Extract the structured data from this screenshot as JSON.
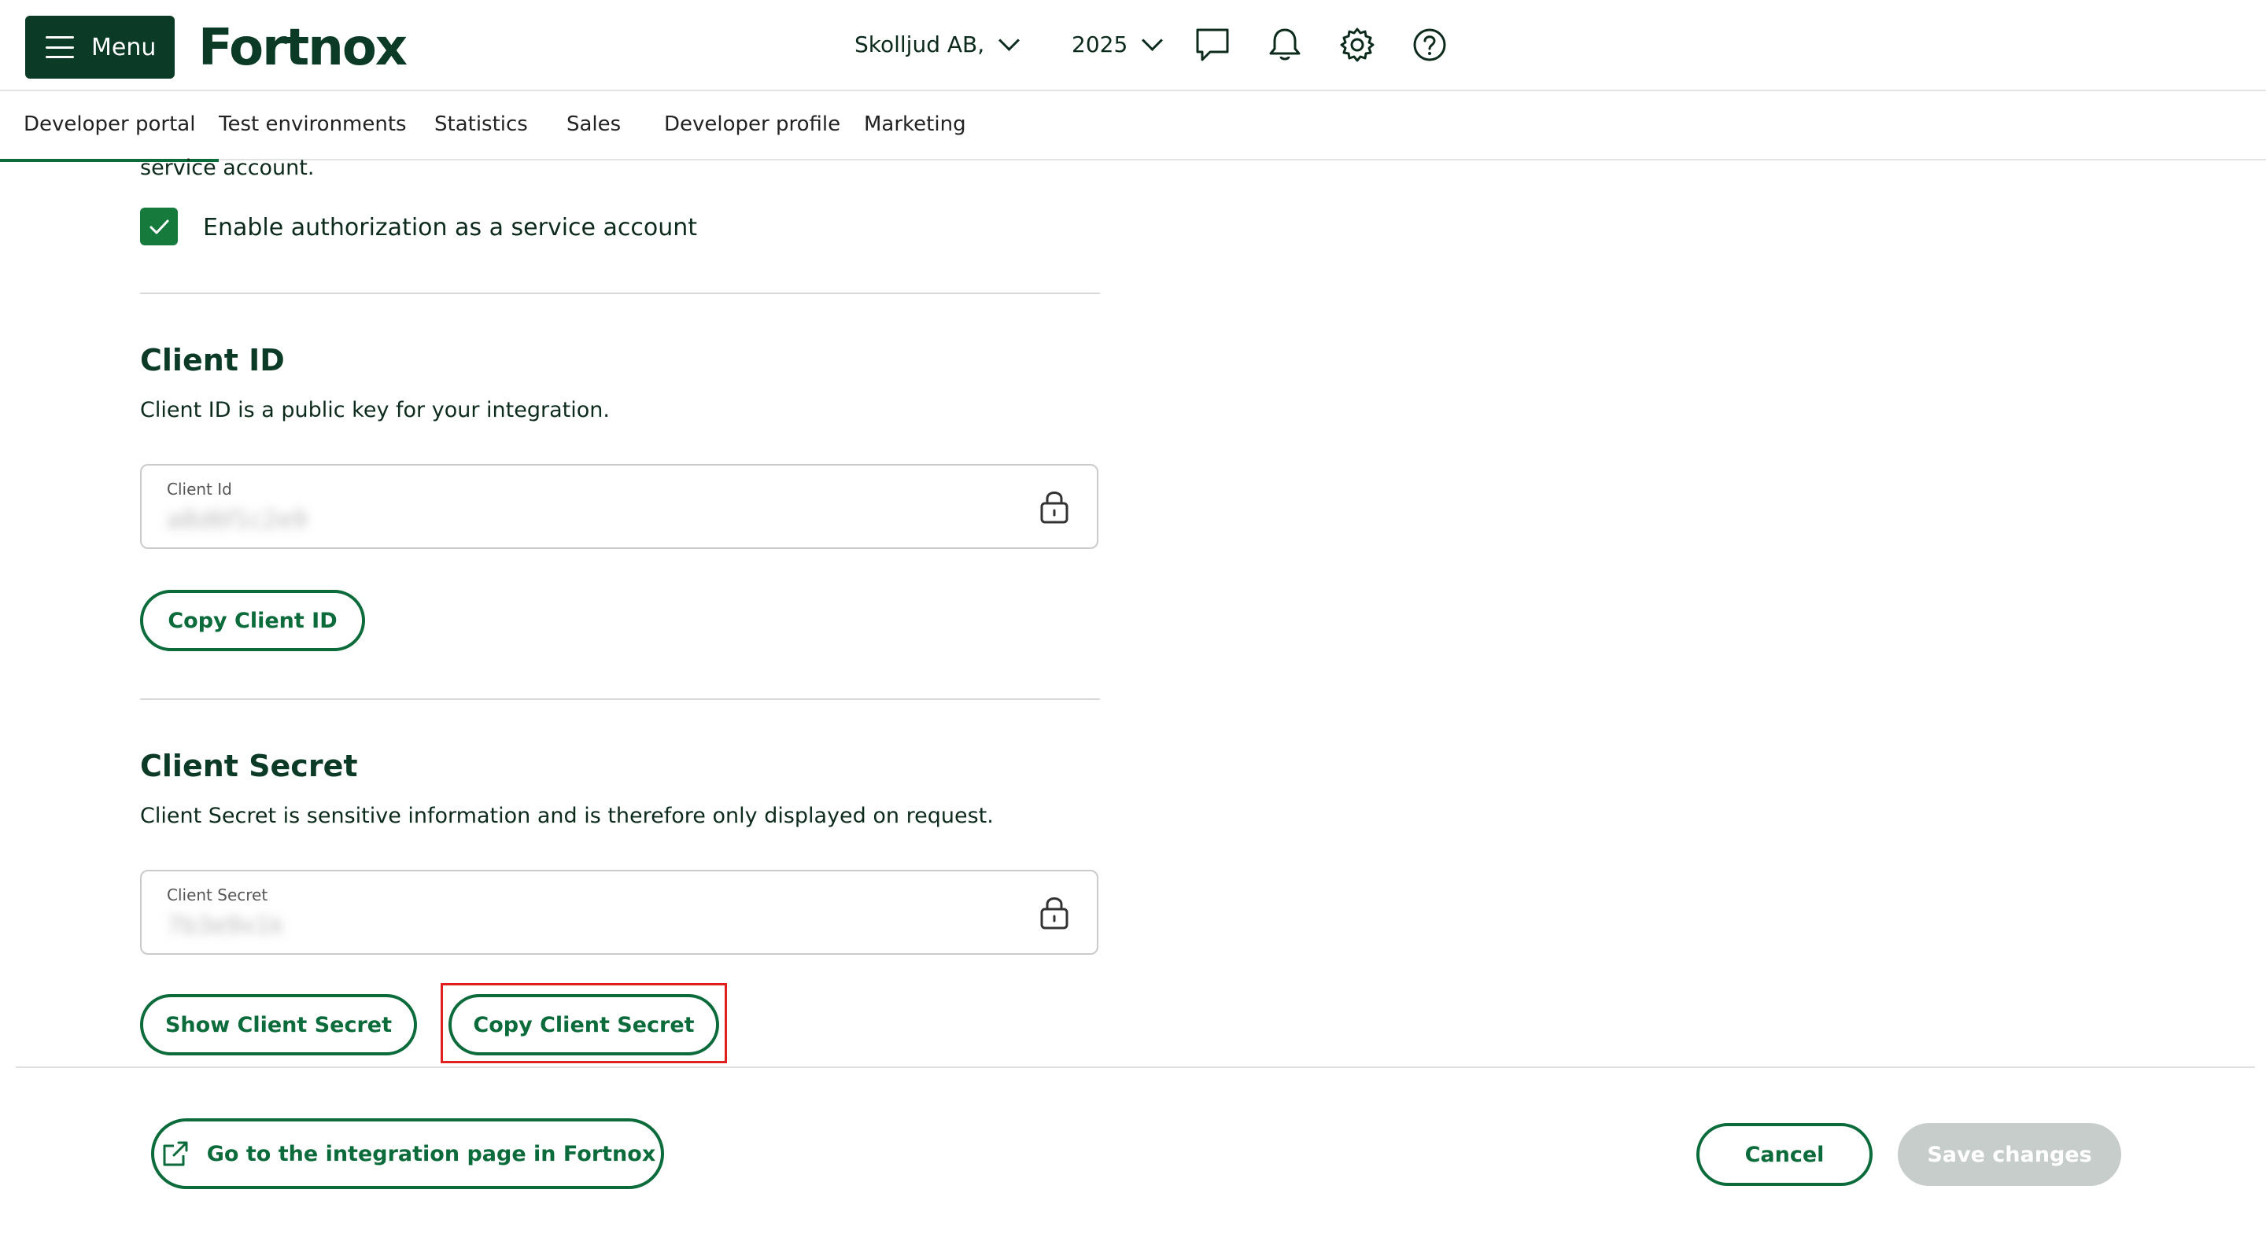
{
  "header": {
    "menu_label": "Menu",
    "logo_text": "Fortnox",
    "company": "Skolljud AB,",
    "year": "2025",
    "icons": [
      "chat-icon",
      "bell-icon",
      "gear-icon",
      "help-icon"
    ]
  },
  "nav": {
    "tabs": [
      {
        "label": "Developer portal",
        "active": true
      },
      {
        "label": "Test environments"
      },
      {
        "label": "Statistics"
      },
      {
        "label": "Sales"
      },
      {
        "label": "Developer profile"
      },
      {
        "label": "Marketing"
      }
    ]
  },
  "service_account": {
    "intro_tail": "service account.",
    "checkbox_label": "Enable authorization as a service account",
    "checked": true
  },
  "client_id": {
    "title": "Client ID",
    "description": "Client ID is a public key for your integration.",
    "field_label": "Client Id",
    "field_value": "a8d6f1c2e9",
    "copy_button": "Copy Client ID"
  },
  "client_secret": {
    "title": "Client Secret",
    "description": "Client Secret is sensitive information and is therefore only displayed on request.",
    "field_label": "Client Secret",
    "field_value": "7b3e9x1k",
    "show_button": "Show Client Secret",
    "copy_button": "Copy Client Secret"
  },
  "footer": {
    "integration_link": "Go to the integration page in Fortnox",
    "cancel": "Cancel",
    "save": "Save changes"
  },
  "colors": {
    "brand_dark": "#0b3a27",
    "brand_green": "#0b6b3a",
    "highlight_red": "#e0201c",
    "disabled": "#c7cdca"
  }
}
